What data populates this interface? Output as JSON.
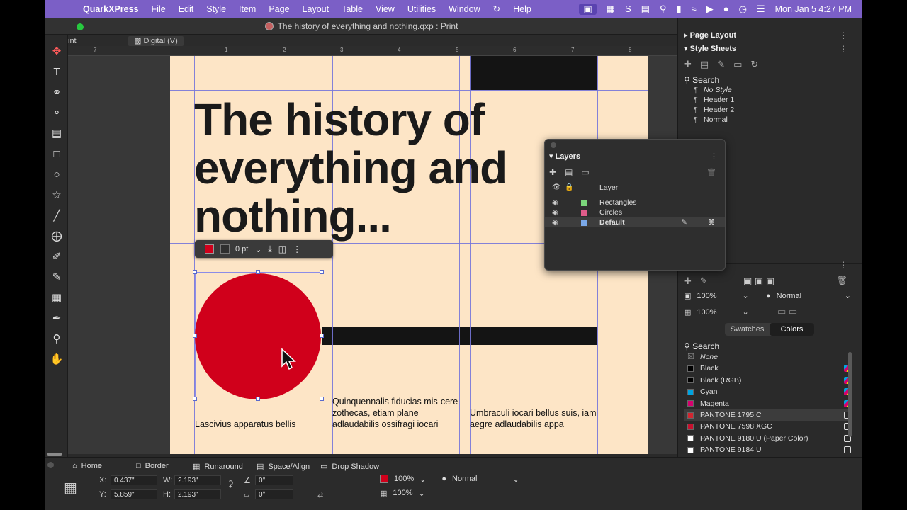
{
  "menubar": {
    "app": "QuarkXPress",
    "items": [
      "File",
      "Edit",
      "Style",
      "Item",
      "Page",
      "Layout",
      "Table",
      "View",
      "Utilities",
      "Window",
      "Help"
    ],
    "clock": "Mon Jan 5  4:27 PM"
  },
  "window": {
    "title": "The history of everything and nothing.qxp : Print",
    "tab_print": "int",
    "tab_digital": "Digital (V)"
  },
  "ruler": {
    "ticks": [
      "7",
      "1",
      "2",
      "3",
      "4",
      "5",
      "6",
      "7",
      "8"
    ]
  },
  "document": {
    "headline": "The history of everything and nothing...",
    "text_col1": "Lascivius apparatus bellis",
    "text_col2": "Quinquennalis fiducias mis-cere zothecas, etiam plane adlaudabilis ossifragi iocari",
    "text_col3": "Umbraculi iocari bellus suis, iam aegre adlaudabilis appa"
  },
  "floatbar": {
    "stroke_width": "0 pt"
  },
  "right_panel": {
    "page_layout": "Page Layout",
    "style_sheets": "Style Sheets",
    "search": "Search",
    "styles": [
      "No Style",
      "Header 1",
      "Header 2",
      "Normal"
    ],
    "opacity1": "100%",
    "opacity2": "100%",
    "blend": "Normal",
    "tab_swatches": "Swatches",
    "tab_colors": "Colors",
    "colors_search": "Search",
    "colors": [
      {
        "name": "None",
        "chip": "none"
      },
      {
        "name": "Black",
        "chip": "#000000"
      },
      {
        "name": "Black (RGB)",
        "chip": "#000000"
      },
      {
        "name": "Cyan",
        "chip": "#00a3e0"
      },
      {
        "name": "Magenta",
        "chip": "#d6006f"
      },
      {
        "name": "PANTONE 1795 C",
        "chip": "#d22630"
      },
      {
        "name": "PANTONE 7598 XGC",
        "chip": "#c8102e"
      },
      {
        "name": "PANTONE 9180 U (Paper Color)",
        "chip": "#ffffff"
      },
      {
        "name": "PANTONE 9184 U",
        "chip": "#ffffff"
      }
    ]
  },
  "layers_palette": {
    "title": "Layers",
    "column": "Layer",
    "layers": [
      {
        "name": "Rectangles",
        "color": "#7bd67b"
      },
      {
        "name": "Circles",
        "color": "#e05c8a"
      },
      {
        "name": "Default",
        "color": "#7aa8e8"
      }
    ]
  },
  "bottom_palette": {
    "tabs": [
      "Home",
      "Border",
      "Runaround",
      "Space/Align",
      "Drop Shadow"
    ],
    "x_label": "X:",
    "x_value": "0.437\"",
    "y_label": "Y:",
    "y_value": "5.859\"",
    "w_label": "W:",
    "w_value": "2.193\"",
    "h_label": "H:",
    "h_value": "2.193\"",
    "angle": "0°",
    "skew": "0°",
    "fill_opacity": "100%",
    "fill_opacity2": "100%",
    "blend": "Normal"
  },
  "colors": {
    "accent": "#7b5fc6",
    "circle": "#d0001b",
    "page": "#fde5c6"
  }
}
